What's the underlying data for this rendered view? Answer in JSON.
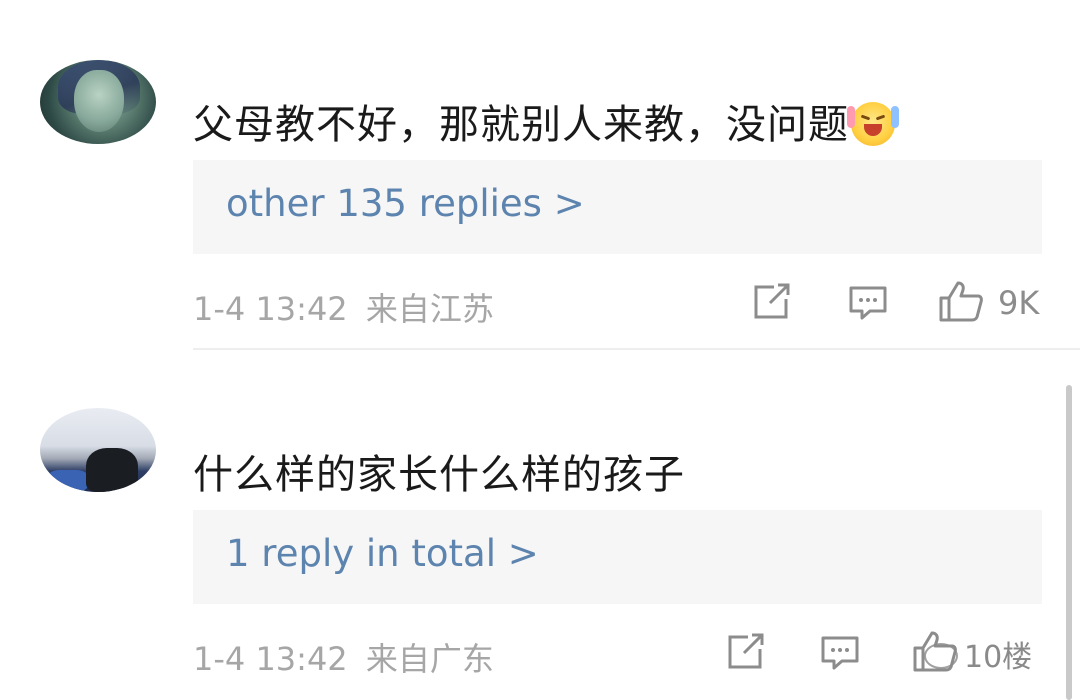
{
  "comments": [
    {
      "text": "父母教不好，那就别人来教，没问题",
      "emoji": "laughing-crying-emoji",
      "replies_label": "other 135 replies >",
      "timestamp": "1-4 13:42",
      "location": "来自江苏",
      "like_count": "9K"
    },
    {
      "text": "什么样的家长什么样的孩子",
      "replies_label": "1 reply in total >",
      "timestamp": "1-4 13:42",
      "location": "来自广东",
      "like_count": ""
    }
  ],
  "watermark": "10楼",
  "colors": {
    "link": "#5d84ae",
    "meta": "#a6a6a6",
    "reply_bg": "#f6f6f6",
    "text": "#1a1a1a"
  },
  "icons": [
    "share-icon",
    "comment-icon",
    "like-icon"
  ]
}
